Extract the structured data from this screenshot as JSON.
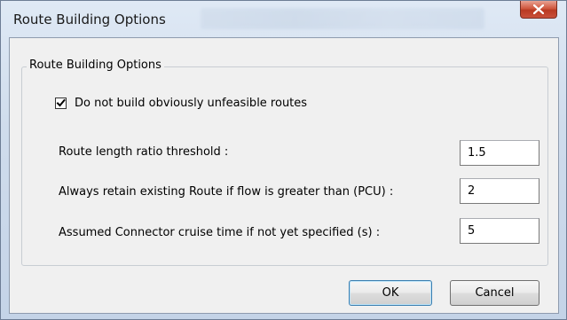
{
  "window": {
    "title": "Route Building Options",
    "close_icon": "close-icon"
  },
  "group": {
    "legend": "Route Building Options"
  },
  "checkbox": {
    "label": "Do not build obviously unfeasible routes",
    "checked": true
  },
  "fields": [
    {
      "label": "Route length ratio threshold :",
      "value": "1.5"
    },
    {
      "label": "Always retain existing Route if flow is greater than (PCU) :",
      "value": "2"
    },
    {
      "label": "Assumed Connector cruise time if not yet specified (s) :",
      "value": "5"
    }
  ],
  "buttons": {
    "ok": "OK",
    "cancel": "Cancel"
  }
}
